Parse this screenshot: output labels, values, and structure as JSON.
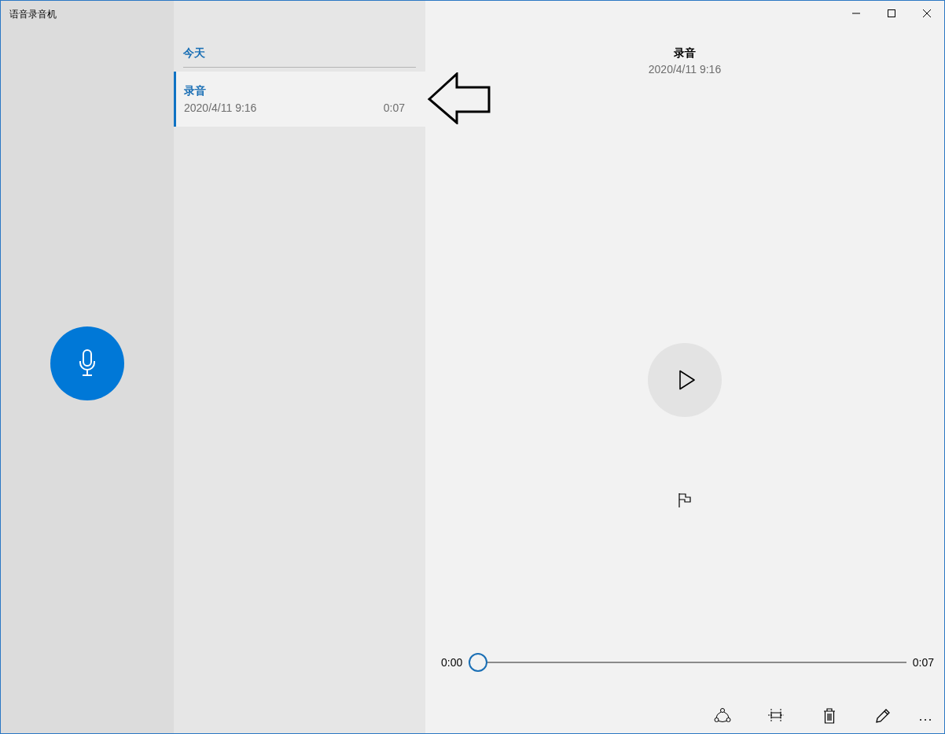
{
  "window": {
    "title": "语音录音机"
  },
  "recordings": {
    "groups": [
      {
        "heading": "今天",
        "items": [
          {
            "name": "录音",
            "date": "2020/4/11 9:16",
            "duration": "0:07",
            "selected": true
          }
        ]
      }
    ]
  },
  "player": {
    "title": "录音",
    "date": "2020/4/11 9:16",
    "position": "0:00",
    "length": "0:07",
    "level": 0
  },
  "toolbar": [
    {
      "kind": "share"
    },
    {
      "kind": "trim"
    },
    {
      "kind": "delete"
    },
    {
      "kind": "rename"
    },
    {
      "kind": "more"
    }
  ]
}
